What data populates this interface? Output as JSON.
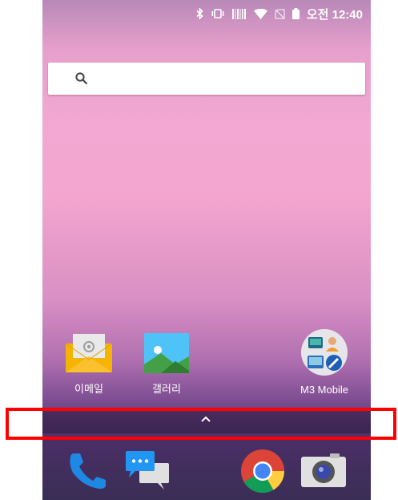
{
  "status_bar": {
    "time": "오전 12:40"
  },
  "search": {
    "placeholder": ""
  },
  "apps": [
    {
      "label": "이메일",
      "icon": "email-icon"
    },
    {
      "label": "갤러리",
      "icon": "gallery-icon"
    },
    {
      "label": "M3 Mobile",
      "icon": "m3-mobile-folder-icon"
    }
  ],
  "dock": [
    "phone-icon",
    "messages-icon",
    "chrome-icon",
    "camera-icon"
  ],
  "colors": {
    "highlight": "#ff0000",
    "search_bg": "#ffffff"
  }
}
